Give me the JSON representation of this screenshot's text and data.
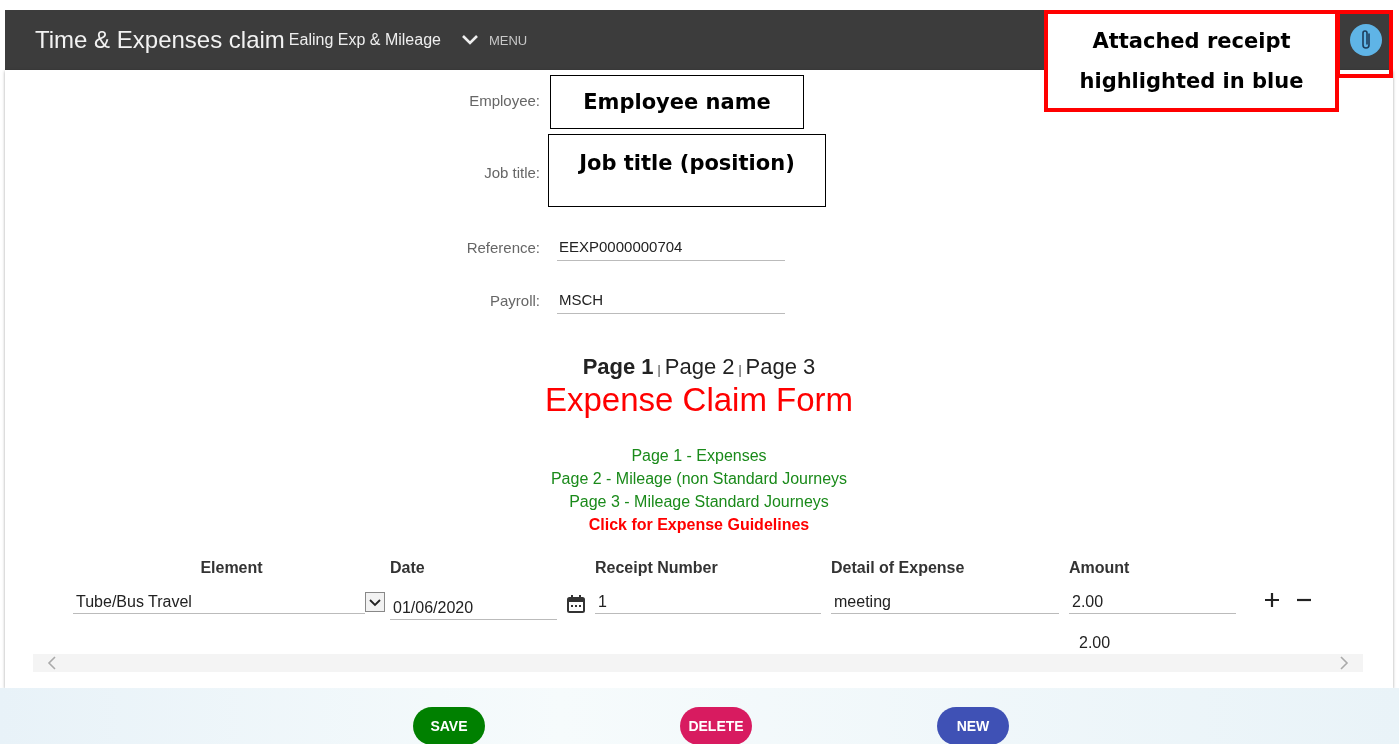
{
  "header": {
    "title": "Time & Expenses claim",
    "subtitle": "Ealing Exp & Mileage",
    "menu_label": "MENU"
  },
  "fields": [
    {
      "label": "Employee:"
    },
    {
      "label": "Job title:"
    },
    {
      "label": "Reference:",
      "value": "EEXP0000000704"
    },
    {
      "label": "Payroll:",
      "value": "MSCH"
    }
  ],
  "pager": [
    {
      "label": "Page 1",
      "selected": true
    },
    {
      "label": "Page 2",
      "selected": false,
      "separator": "|"
    },
    {
      "label": "Page 3",
      "selected": false,
      "separator": "|"
    }
  ],
  "form_title": "Expense Claim Form",
  "links": [
    {
      "text": "Page 1 - Expenses",
      "kind": "section"
    },
    {
      "text": "Page 2 - Mileage (non Standard Journeys",
      "kind": "section"
    },
    {
      "text": "Page 3 - Mileage Standard Journeys",
      "kind": "section"
    },
    {
      "text": "Click for Expense Guidelines",
      "kind": "guideline"
    }
  ],
  "table": {
    "columns": [
      "Element",
      "Date",
      "Receipt Number",
      "Detail of Expense",
      "Amount"
    ],
    "rows": [
      {
        "element": "Tube/Bus Travel",
        "date": "01/06/2020",
        "receipt_number": "1",
        "detail": "meeting",
        "amount": "2.00"
      }
    ],
    "total": "2.00"
  },
  "buttons": [
    {
      "label": "SAVE",
      "color": "#008000"
    },
    {
      "label": "DELETE",
      "color": "#d81b60"
    },
    {
      "label": "NEW",
      "color": "#3f51b5"
    }
  ],
  "annotations": [
    {
      "text": "Employee name"
    },
    {
      "text": "Job title (position)"
    },
    {
      "text": "Attached receipt highlighted in blue"
    }
  ]
}
